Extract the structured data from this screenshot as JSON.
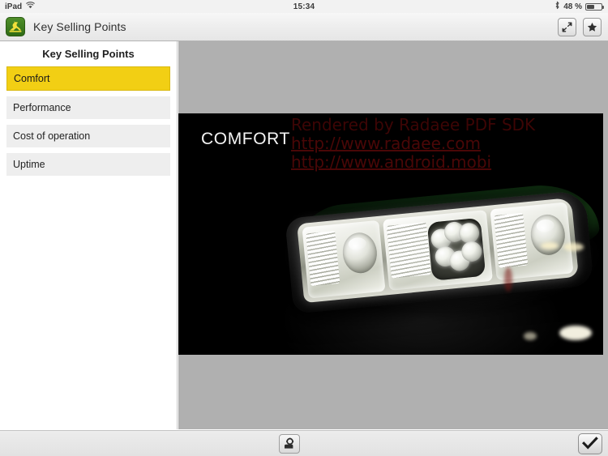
{
  "status_bar": {
    "device_label": "iPad",
    "wifi_icon": "wifi-icon",
    "time": "15:34",
    "bluetooth_icon": "bluetooth-icon",
    "battery_percent": "48 %",
    "battery_level": 48
  },
  "nav_bar": {
    "logo_icon": "john-deere-logo-icon",
    "title": "Key Selling Points",
    "buttons": [
      {
        "name": "collapse-arrows-button",
        "icon": "collapse-arrows-icon"
      },
      {
        "name": "favorite-button",
        "icon": "star-icon"
      }
    ]
  },
  "sidebar": {
    "title": "Key Selling Points",
    "items": [
      {
        "label": "Comfort",
        "selected": true
      },
      {
        "label": "Performance",
        "selected": false
      },
      {
        "label": "Cost of operation",
        "selected": false
      },
      {
        "label": "Uptime",
        "selected": false
      }
    ]
  },
  "pdf_viewer": {
    "slide_title": "COMFORT",
    "watermark": {
      "line1": "Rendered by Radaee PDF SDK",
      "line2": "http://www.radaee.com",
      "line3": "http://www.android.mobi"
    },
    "image_description": "Tractor LED headlight assembly at night"
  },
  "toolbar": {
    "present_button_icon": "projector-icon",
    "confirm_button_icon": "checkmark-icon"
  },
  "colors": {
    "accent_yellow": "#f2cf14",
    "sidebar_item_bg": "#eeeeee",
    "viewer_bg": "#b0b0b0",
    "slide_bg": "#000000",
    "watermark_red": "#3d0505",
    "deere_green": "#2f7f2c"
  }
}
